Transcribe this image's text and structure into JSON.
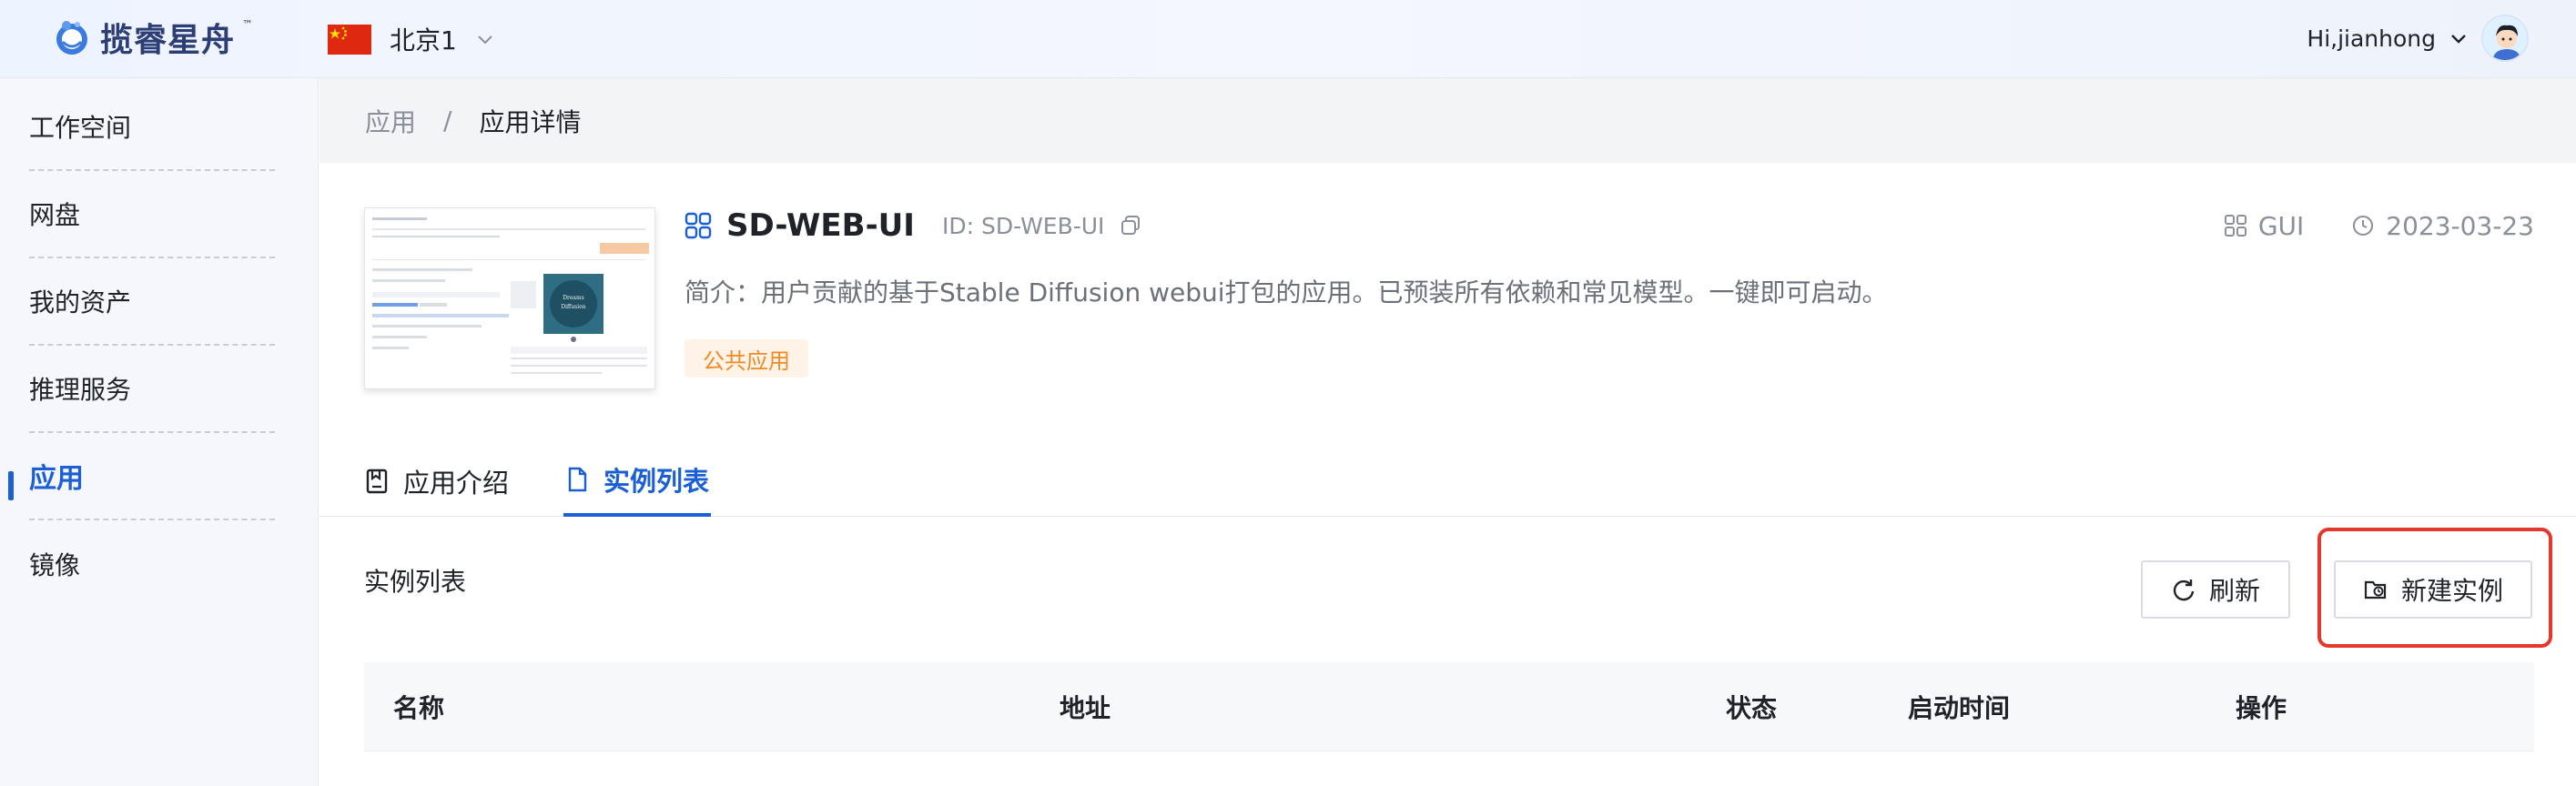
{
  "header": {
    "logo_text": "揽睿星舟",
    "logo_tm": "™",
    "region": "北京1",
    "user_greeting": "Hi,jianhong"
  },
  "sidebar": {
    "items": [
      {
        "label": "工作空间"
      },
      {
        "label": "网盘"
      },
      {
        "label": "我的资产"
      },
      {
        "label": "推理服务"
      },
      {
        "label": "应用",
        "active": true
      },
      {
        "label": "镜像"
      }
    ]
  },
  "breadcrumb": {
    "parent": "应用",
    "separator": "/",
    "current": "应用详情"
  },
  "app": {
    "name": "SD-WEB-UI",
    "id_text": "ID: SD-WEB-UI",
    "type": "GUI",
    "date": "2023-03-23",
    "description": "简介：用户贡献的基于Stable Diffusion webui打包的应用。已预装所有依赖和常见模型。一键即可启动。",
    "tag": "公共应用",
    "thumbnail_caption": "Dreams Diffusion"
  },
  "tabs": [
    {
      "label": "应用介绍",
      "icon": "document-icon",
      "active": false
    },
    {
      "label": "实例列表",
      "icon": "file-icon",
      "active": true
    }
  ],
  "instances": {
    "title": "实例列表",
    "refresh_label": "刷新",
    "new_label": "新建实例",
    "columns": [
      "名称",
      "地址",
      "状态",
      "启动时间",
      "操作"
    ]
  },
  "colors": {
    "accent": "#1a5fd6",
    "highlight_box": "#e3382b",
    "tag_text": "#f08a24",
    "tag_bg": "#fff3e8"
  }
}
